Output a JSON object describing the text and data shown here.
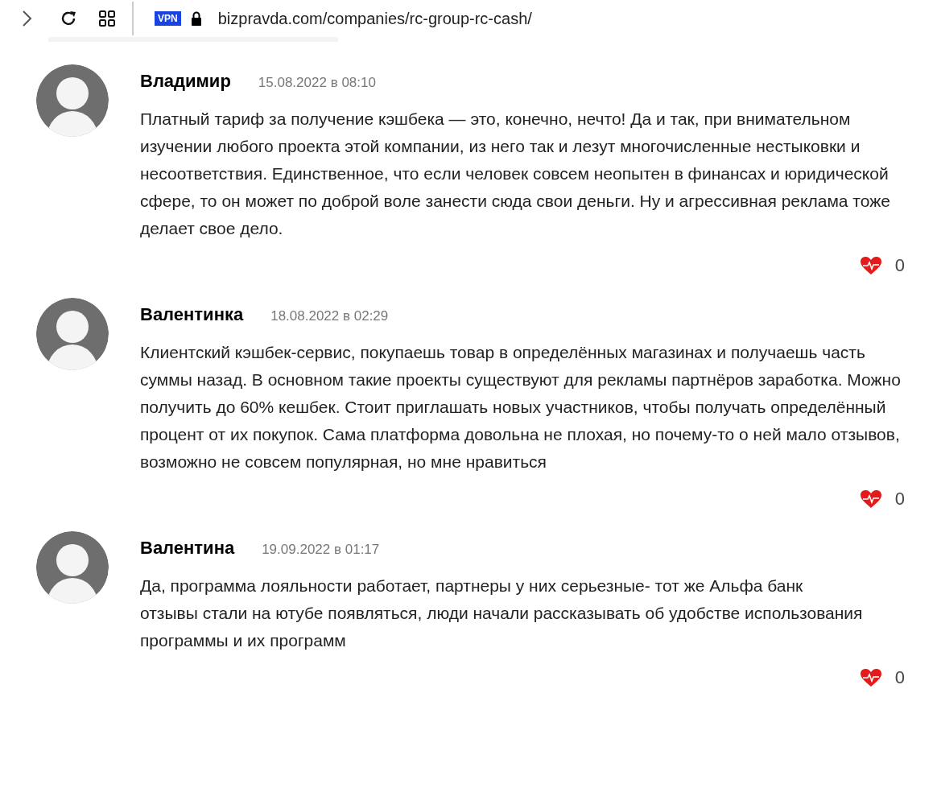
{
  "toolbar": {
    "vpn_badge": "VPN",
    "url": "bizpravda.com/companies/rc-group-rc-cash/"
  },
  "comments": [
    {
      "author": "Владимир",
      "date": "15.08.2022 в 08:10",
      "paragraphs": [
        "Платный тариф за получение кэшбека — это, конечно, нечто! Да и так, при внимательном изучении любого проекта этой компании, из него так и лезут многочисленные нестыковки и несоответствия. Единственное, что если человек совсем неопытен в финансах и юридической сфере, то он может по доброй воле занести сюда свои деньги. Ну и агрессивная реклама тоже делает свое дело."
      ],
      "likes": "0"
    },
    {
      "author": "Валентинка",
      "date": "18.08.2022 в 02:29",
      "paragraphs": [
        "Клиентский кэшбек-сервис, покупаешь товар в определённых магазинах и получаешь часть суммы назад. В основном такие проекты существуют для рекламы партнёров заработка. Можно получить до 60% кешбек. Стоит приглашать новых участников, чтобы получать определённый процент от их покупок. Сама платформа довольна не плохая, но почему-то о ней мало отзывов, возможно не совсем популярная, но мне нравиться"
      ],
      "likes": "0"
    },
    {
      "author": "Валентина",
      "date": "19.09.2022 в 01:17",
      "paragraphs": [
        "Да, программа лояльности работает, партнеры у них серьезные- тот же Альфа банк",
        "отзывы стали на ютубе появляться, люди начали рассказывать об удобстве использования программы и их программ"
      ],
      "likes": "0"
    }
  ]
}
